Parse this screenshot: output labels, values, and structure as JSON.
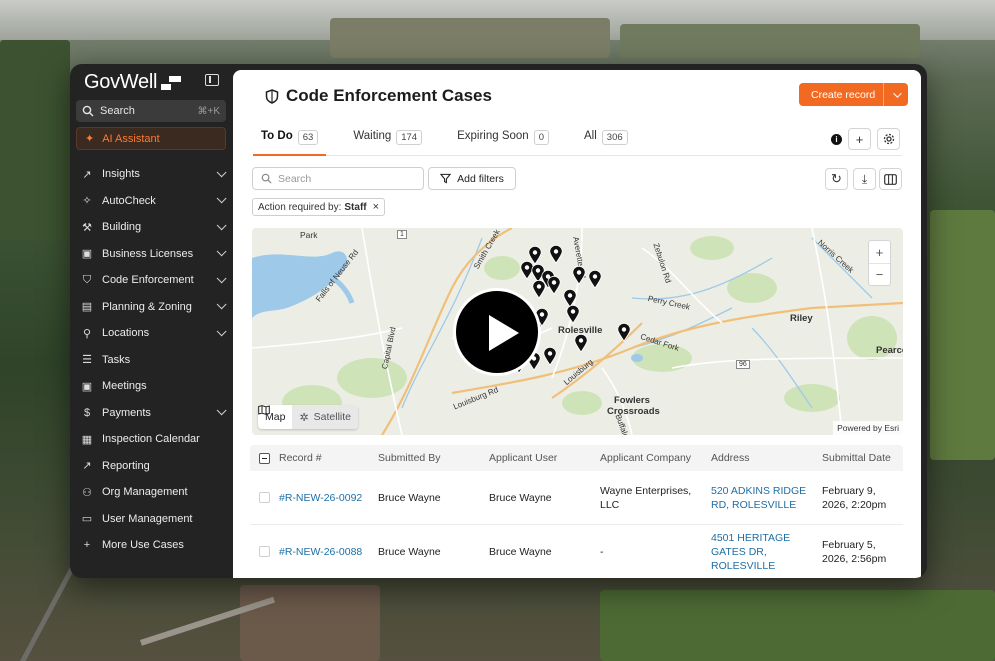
{
  "sidebar": {
    "logo": "GovWell",
    "search_label": "Search",
    "search_shortcut": "⌘+K",
    "ai_label": "AI Assistant",
    "items": [
      {
        "label": "Insights",
        "icon": "chart-line-icon",
        "glyph": "↗",
        "chevron": true
      },
      {
        "label": "AutoCheck",
        "icon": "magic-wand-icon",
        "glyph": "✧",
        "chevron": true
      },
      {
        "label": "Building",
        "icon": "hammer-icon",
        "glyph": "⚒",
        "chevron": true
      },
      {
        "label": "Business Licenses",
        "icon": "briefcase-icon",
        "glyph": "▣",
        "chevron": true
      },
      {
        "label": "Code Enforcement",
        "icon": "shield-icon",
        "glyph": "⛉",
        "chevron": true
      },
      {
        "label": "Planning & Zoning",
        "icon": "book-icon",
        "glyph": "▤",
        "chevron": true
      },
      {
        "label": "Locations",
        "icon": "location-pin-icon",
        "glyph": "⚲",
        "chevron": true
      },
      {
        "label": "Tasks",
        "icon": "checklist-icon",
        "glyph": "☰",
        "chevron": false
      },
      {
        "label": "Meetings",
        "icon": "briefcase-icon",
        "glyph": "▣",
        "chevron": false
      },
      {
        "label": "Payments",
        "icon": "dollar-icon",
        "glyph": "$",
        "chevron": true
      },
      {
        "label": "Inspection Calendar",
        "icon": "calendar-icon",
        "glyph": "▦",
        "chevron": false
      },
      {
        "label": "Reporting",
        "icon": "report-chart-icon",
        "glyph": "↗",
        "chevron": false
      },
      {
        "label": "Org Management",
        "icon": "users-icon",
        "glyph": "⚇",
        "chevron": false
      },
      {
        "label": "User Management",
        "icon": "id-card-icon",
        "glyph": "▭",
        "chevron": false
      },
      {
        "label": "More Use Cases",
        "icon": "plus-icon",
        "glyph": "+",
        "chevron": false
      }
    ]
  },
  "header": {
    "title": "Code Enforcement Cases",
    "create_label": "Create record"
  },
  "tabs": [
    {
      "label": "To Do",
      "count": "63"
    },
    {
      "label": "Waiting",
      "count": "174"
    },
    {
      "label": "Expiring Soon",
      "count": "0"
    },
    {
      "label": "All",
      "count": "306"
    }
  ],
  "toolbar": {
    "search_placeholder": "Search",
    "filters_label": "Add filters",
    "chip_prefix": "Action required by:",
    "chip_value": "Staff"
  },
  "map": {
    "labels": [
      "Rolesville",
      "Riley",
      "Pearce",
      "Fowlers",
      "Crossroads",
      "Park",
      "Falls of Neuse Rd",
      "Capital Blvd",
      "Smith Creek",
      "Louisburg Rd",
      "Perry Creek",
      "Cedar Fork",
      "Zebulon Rd",
      "Norris Creek",
      "Louisburg",
      "Buffalo",
      "Averette Rd",
      "1",
      "96"
    ],
    "map_label": "Map",
    "satellite_label": "Satellite",
    "attribution": "Powered by Esri"
  },
  "table": {
    "columns": [
      "Record #",
      "Submitted By",
      "Applicant User",
      "Applicant Company",
      "Address",
      "Submittal Date"
    ],
    "rows": [
      {
        "record": "#R-NEW-26-0092",
        "submitted_by": "Bruce Wayne",
        "applicant_user": "Bruce Wayne",
        "company": "Wayne Enterprises, LLC",
        "address": "520 ADKINS RIDGE RD, ROLESVILLE",
        "date": "February 9, 2026, 2:20pm"
      },
      {
        "record": "#R-NEW-26-0088",
        "submitted_by": "Bruce Wayne",
        "applicant_user": "Bruce Wayne",
        "company": "-",
        "address": "4501 HERITAGE GATES DR, ROLESVILLE",
        "date": "February 5, 2026, 2:56pm"
      }
    ]
  },
  "colors": {
    "accent": "#f26a21",
    "link": "#1d6fa5",
    "sidebar_bg": "#232323"
  }
}
